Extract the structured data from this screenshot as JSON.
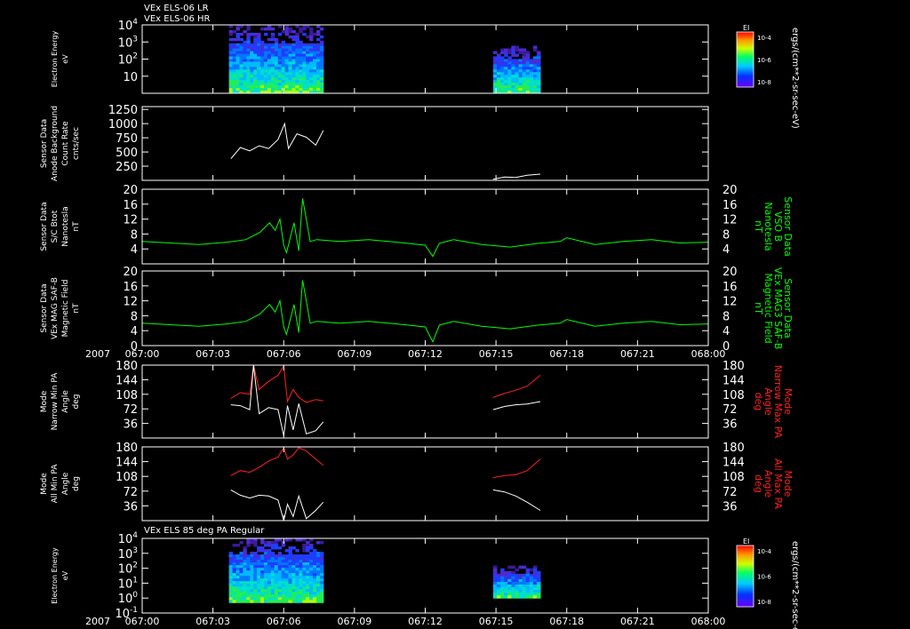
{
  "chart_data": {
    "type": "line",
    "header_lines": [
      "VEx ELS-06 LR",
      "VEx ELS-06 HR"
    ],
    "x_axis": {
      "year_label": "2007",
      "tick_labels": [
        "067:00",
        "067:03",
        "067:06",
        "067:09",
        "067:12",
        "067:15",
        "067:18",
        "067:21",
        "068:00"
      ],
      "range_minutes": [
        0,
        60
      ]
    },
    "panels": [
      {
        "id": "els_lr_hr",
        "type": "heatmap",
        "ylabel": [
          "Electron Energy",
          "eV"
        ],
        "yticks": [
          "10^4",
          "10^3",
          "10^2",
          "10"
        ],
        "yscale": "log",
        "ylim": [
          1,
          10000
        ],
        "colorbar": {
          "title": "EI",
          "ticks": [
            "10^-4",
            "10^-6",
            "10^-8"
          ]
        },
        "right_label": "ergs/(cm**2-sr-sec-eV)",
        "data_blocks": [
          {
            "x_start": 9.2,
            "x_end": 19.2,
            "y_range": [
              0.5,
              18000
            ]
          },
          {
            "x_start": 37.2,
            "x_end": 42.2,
            "y_range": [
              1,
              600
            ]
          }
        ]
      },
      {
        "id": "anode_background",
        "type": "line",
        "ylabel": [
          "Sensor Data",
          "Anode Background",
          "Count Rate",
          "cnts/sec"
        ],
        "yticks": [
          250,
          500,
          750,
          1000,
          1250
        ],
        "ylim": [
          0,
          1300
        ],
        "series": [
          {
            "color": "#ffffff",
            "segments": [
              {
                "x": [
                  9.4,
                  10.4,
                  11.4,
                  12.4,
                  13.4,
                  14.4,
                  15.1,
                  15.5,
                  16.4,
                  17.4,
                  18.4,
                  19.2
                ],
                "y": [
                  380,
                  580,
                  520,
                  610,
                  560,
                  720,
                  1000,
                  560,
                  820,
                  760,
                  620,
                  880
                ]
              },
              {
                "x": [
                  37.2,
                  38.4,
                  39.6,
                  40.8,
                  42.2
                ],
                "y": [
                  20,
                  60,
                  50,
                  90,
                  110
                ]
              }
            ]
          }
        ]
      },
      {
        "id": "bmag_sc",
        "type": "line",
        "ylabel": [
          "Sensor Data",
          "S/C Btot",
          "Nanotesla",
          "nT"
        ],
        "right_label": [
          "Sensor Data",
          "VSO B",
          "Nanotesla",
          "nT"
        ],
        "yticks": [
          4,
          8,
          12,
          16,
          20
        ],
        "ylim": [
          0,
          20
        ],
        "series": [
          {
            "color": "#00ff00",
            "segments": [
              {
                "x": [
                  0,
                  3,
                  6,
                  9,
                  11,
                  12.5,
                  13.5,
                  14.1,
                  14.6,
                  15.0,
                  15.3,
                  15.6,
                  16.1,
                  16.6,
                  17.0,
                  17.4,
                  17.8,
                  18.5,
                  21,
                  24,
                  27,
                  30,
                  30.8,
                  31.5,
                  33,
                  36,
                  39,
                  42,
                  44.3,
                  45,
                  48,
                  51,
                  54,
                  57,
                  60
                ],
                "y": [
                  6,
                  5.6,
                  5.2,
                  5.8,
                  6.5,
                  8.5,
                  11,
                  9,
                  12,
                  5,
                  3,
                  6,
                  11,
                  3.5,
                  17.5,
                  12,
                  6,
                  6.5,
                  6,
                  6.5,
                  5.8,
                  5,
                  2,
                  5.5,
                  6.5,
                  5.2,
                  4.5,
                  5.5,
                  6,
                  7,
                  5.2,
                  6,
                  6.5,
                  5.6,
                  5.8
                ]
              }
            ]
          }
        ]
      },
      {
        "id": "mag_saf_b",
        "type": "line",
        "ylabel": [
          "Sensor Data",
          "VEx MAG SAF-B",
          "Magnetic Field",
          "nT"
        ],
        "right_label": [
          "Sensor Data",
          "VEx MAG3 SAF-B",
          "Magnetic Field",
          "nT"
        ],
        "yticks": [
          0,
          4,
          8,
          12,
          16,
          20
        ],
        "ylim": [
          0,
          20
        ],
        "series": [
          {
            "color": "#00ff00",
            "segments": [
              {
                "x": [
                  0,
                  3,
                  6,
                  9,
                  11,
                  12.5,
                  13.5,
                  14.1,
                  14.6,
                  15.0,
                  15.3,
                  15.6,
                  16.1,
                  16.6,
                  17.0,
                  17.4,
                  17.8,
                  18.5,
                  21,
                  24,
                  27,
                  30,
                  30.8,
                  31.5,
                  33,
                  36,
                  39,
                  42,
                  44.3,
                  45,
                  48,
                  51,
                  54,
                  57,
                  60
                ],
                "y": [
                  6,
                  5.6,
                  5.2,
                  5.8,
                  6.5,
                  8.5,
                  11,
                  9,
                  12,
                  5,
                  3,
                  6,
                  11,
                  3.5,
                  17.5,
                  12,
                  6,
                  6.5,
                  6,
                  6.5,
                  5.8,
                  5,
                  1,
                  5.5,
                  6.5,
                  5.2,
                  4.5,
                  5.5,
                  6,
                  7,
                  5.2,
                  6,
                  6.5,
                  5.6,
                  5.8
                ]
              }
            ]
          }
        ]
      },
      {
        "id": "narrow_pa",
        "type": "line",
        "ylabel": [
          "Mode",
          "Narrow Min PA",
          "Angle",
          "deg"
        ],
        "right_label": [
          "Mode",
          "Narrow Max PA",
          "Angle",
          "deg"
        ],
        "yticks": [
          36,
          72,
          108,
          144,
          180
        ],
        "ylim": [
          0,
          180
        ],
        "series": [
          {
            "color": "#ff2020",
            "segments": [
              {
                "x": [
                  9.4,
                  10.4,
                  11.4,
                  11.8,
                  12.4,
                  13.4,
                  14.4,
                  15.0,
                  15.4,
                  16.0,
                  16.6,
                  17.4,
                  18.4,
                  19.2
                ],
                "y": [
                  98,
                  112,
                  108,
                  180,
                  120,
                  140,
                  155,
                  178,
                  90,
                  120,
                  100,
                  88,
                  95,
                  92
                ]
              },
              {
                "x": [
                  37.2,
                  38.4,
                  39.6,
                  40.8,
                  42.2
                ],
                "y": [
                  100,
                  110,
                  118,
                  128,
                  155
                ]
              }
            ]
          },
          {
            "color": "#ffffff",
            "segments": [
              {
                "x": [
                  9.4,
                  10.4,
                  11.4,
                  11.8,
                  12.4,
                  13.4,
                  14.4,
                  15.0,
                  15.4,
                  16.0,
                  16.6,
                  17.4,
                  18.4,
                  19.2
                ],
                "y": [
                  82,
                  80,
                  70,
                  180,
                  60,
                  75,
                  70,
                  5,
                  80,
                  20,
                  85,
                  10,
                  18,
                  40
                ]
              },
              {
                "x": [
                  37.2,
                  38.4,
                  39.6,
                  40.8,
                  42.2
                ],
                "y": [
                  70,
                  78,
                  82,
                  84,
                  90
                ]
              }
            ]
          }
        ]
      },
      {
        "id": "all_pa",
        "type": "line",
        "ylabel": [
          "Mode",
          "All Min PA",
          "Angle",
          "deg"
        ],
        "right_label": [
          "Mode",
          "All Max PA",
          "Angle",
          "deg"
        ],
        "yticks": [
          36,
          72,
          108,
          144,
          180
        ],
        "ylim": [
          0,
          180
        ],
        "series": [
          {
            "color": "#ff2020",
            "segments": [
              {
                "x": [
                  9.4,
                  10.4,
                  11.4,
                  12.4,
                  13.4,
                  14.4,
                  15.0,
                  15.4,
                  16.0,
                  16.6,
                  17.4,
                  18.4,
                  19.2
                ],
                "y": [
                  110,
                  122,
                  118,
                  130,
                  145,
                  155,
                  178,
                  150,
                  160,
                  178,
                  170,
                  150,
                  135
                ]
              },
              {
                "x": [
                  37.2,
                  38.4,
                  39.6,
                  40.8,
                  42.2
                ],
                "y": [
                  105,
                  110,
                  112,
                  122,
                  150
                ]
              }
            ]
          },
          {
            "color": "#ffffff",
            "segments": [
              {
                "x": [
                  9.4,
                  10.4,
                  11.4,
                  12.4,
                  13.4,
                  14.4,
                  15.0,
                  15.4,
                  16.0,
                  16.6,
                  17.4,
                  18.4,
                  19.2
                ],
                "y": [
                  75,
                  62,
                  55,
                  62,
                  60,
                  50,
                  0,
                  40,
                  10,
                  60,
                  5,
                  25,
                  45
                ]
              },
              {
                "x": [
                  37.2,
                  38.4,
                  39.6,
                  40.8,
                  42.2
                ],
                "y": [
                  75,
                  70,
                  60,
                  45,
                  25
                ]
              }
            ]
          }
        ]
      },
      {
        "id": "els_85",
        "type": "heatmap",
        "title": "VEx ELS 85 deg PA Regular",
        "ylabel": [
          "Electron Energy",
          "eV"
        ],
        "yticks": [
          "10^4",
          "10^3",
          "10^2",
          "10^1",
          "10^0",
          "10^-1"
        ],
        "yscale": "log",
        "ylim": [
          0.1,
          10000
        ],
        "colorbar": {
          "title": "EI",
          "ticks": [
            "10^-4",
            "10^-6",
            "10^-8"
          ]
        },
        "right_label": "ergs/(cm**2-sr-sec-eV)",
        "data_blocks": [
          {
            "x_start": 9.2,
            "x_end": 19.2,
            "y_range": [
              0.5,
              20000
            ]
          },
          {
            "x_start": 37.2,
            "x_end": 42.2,
            "y_range": [
              1,
              150
            ]
          }
        ]
      }
    ]
  }
}
